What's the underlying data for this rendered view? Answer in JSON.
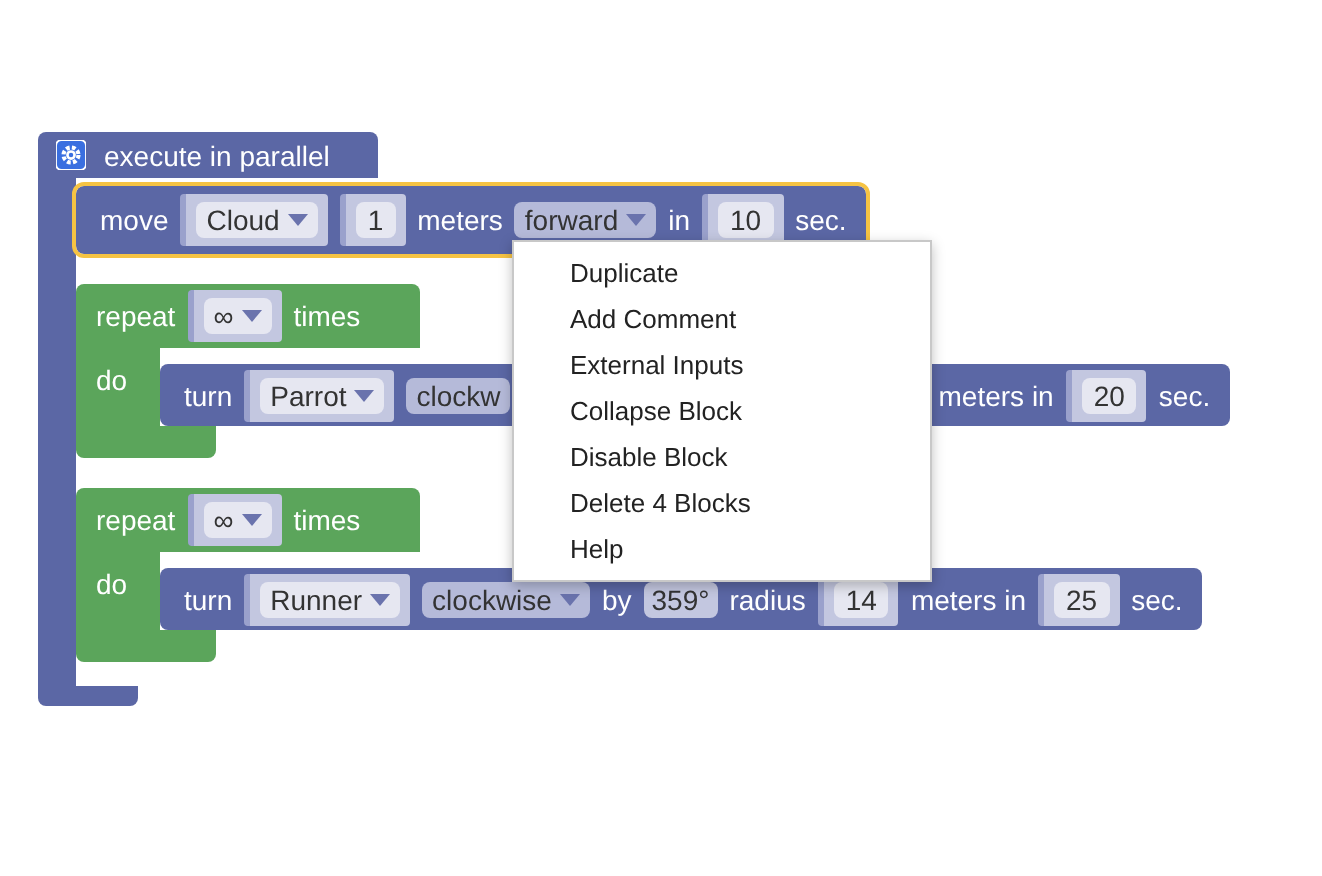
{
  "workspace": {
    "root_block": {
      "label": "execute in parallel",
      "statements": [
        {
          "kind": "action",
          "selected": true,
          "parts": [
            {
              "kind": "label",
              "text": "move"
            },
            {
              "kind": "socket-dropdown",
              "text": "Cloud"
            },
            {
              "kind": "socket-number",
              "text": "1"
            },
            {
              "kind": "label",
              "text": "meters"
            },
            {
              "kind": "dropdown",
              "text": "forward"
            },
            {
              "kind": "label",
              "text": "in"
            },
            {
              "kind": "socket-number",
              "text": "10"
            },
            {
              "kind": "label",
              "text": "sec."
            }
          ]
        },
        {
          "kind": "repeat",
          "header": [
            {
              "kind": "label",
              "text": "repeat"
            },
            {
              "kind": "socket-dropdown",
              "text": "∞"
            },
            {
              "kind": "label",
              "text": "times"
            }
          ],
          "do_label": "do",
          "body": [
            {
              "kind": "action",
              "selected": false,
              "parts": [
                {
                  "kind": "label",
                  "text": "turn"
                },
                {
                  "kind": "socket-dropdown",
                  "text": "Parrot"
                },
                {
                  "kind": "dropdown",
                  "text": "clockw",
                  "covered": true
                },
                {
                  "kind": "label",
                  "text": "meters in"
                },
                {
                  "kind": "socket-number",
                  "text": "20"
                },
                {
                  "kind": "label",
                  "text": "sec."
                }
              ]
            }
          ]
        },
        {
          "kind": "repeat",
          "header": [
            {
              "kind": "label",
              "text": "repeat"
            },
            {
              "kind": "socket-dropdown",
              "text": "∞"
            },
            {
              "kind": "label",
              "text": "times"
            }
          ],
          "do_label": "do",
          "body": [
            {
              "kind": "action",
              "selected": false,
              "parts": [
                {
                  "kind": "label",
                  "text": "turn"
                },
                {
                  "kind": "socket-dropdown",
                  "text": "Runner"
                },
                {
                  "kind": "dropdown",
                  "text": "clockwise"
                },
                {
                  "kind": "label",
                  "text": "by"
                },
                {
                  "kind": "angle",
                  "text": "359°"
                },
                {
                  "kind": "label",
                  "text": "radius"
                },
                {
                  "kind": "socket-number",
                  "text": "14"
                },
                {
                  "kind": "label",
                  "text": "meters in"
                },
                {
                  "kind": "socket-number",
                  "text": "25"
                },
                {
                  "kind": "label",
                  "text": "sec."
                }
              ]
            }
          ]
        }
      ]
    }
  },
  "context_menu": {
    "items": [
      "Duplicate",
      "Add Comment",
      "External Inputs",
      "Collapse Block",
      "Disable Block",
      "Delete 4 Blocks",
      "Help"
    ]
  }
}
